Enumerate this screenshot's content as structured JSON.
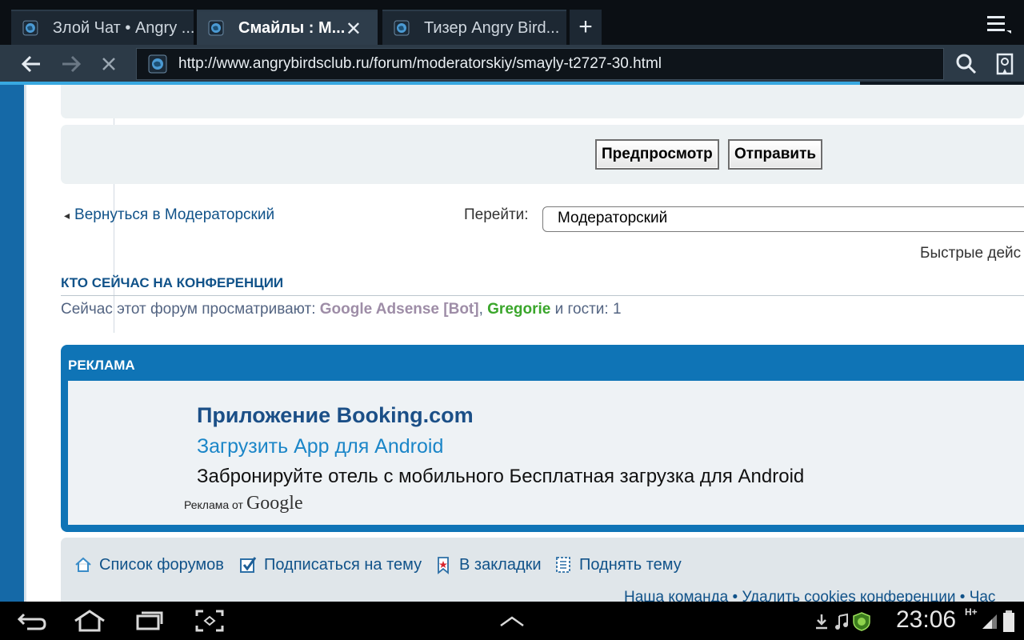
{
  "browser": {
    "tabs": [
      {
        "label": "Злой Чат • Angry ...",
        "active": false
      },
      {
        "label": "Смайлы : М...",
        "active": true
      },
      {
        "label": "Тизер Angry Bird..."
      }
    ],
    "new_tab_label": "+",
    "close_tab_label": "✕",
    "url": "http://www.angrybirdsclub.ru/forum/moderatorskiy/smayly-t2727-30.html",
    "load_progress": 0.84
  },
  "post_form": {
    "preview_label": "Предпросмотр",
    "submit_label": "Отправить"
  },
  "navigation": {
    "back_arrow": "◂",
    "back_link": "Вернуться в Модераторский",
    "jump_label": "Перейти:",
    "jump_selected": "Модераторский",
    "quick_actions": "Быстрые дейс"
  },
  "who_online": {
    "title": "КТО СЕЙЧАС НА КОНФЕРЕНЦИИ",
    "prefix": "Сейчас этот форум просматривают: ",
    "bot": "Google Adsense [Bot]",
    "comma": ", ",
    "user": "Gregorie",
    "suffix": " и гости: 1"
  },
  "ad": {
    "header": "РЕКЛАМА",
    "title": "Приложение Booking.com",
    "subtitle": "Загрузить App для Android",
    "description": "Забронируйте отель с мобильного Бесплатная загрузка для Android",
    "by_label": "Реклама от",
    "google_label": "Google"
  },
  "footer": {
    "forum_list": "Список форумов",
    "subscribe": "Подписаться на тему",
    "bookmark": "В закладки",
    "bump": "Поднять тему",
    "links": "Наша команда • Удалить cookies конференции • Час"
  },
  "system_bar": {
    "clock": "23:06",
    "network": "H+"
  },
  "colors": {
    "link": "#105289",
    "bot": "#9e8da7",
    "user": "#3aa62b",
    "ad_frame": "#0f74b6",
    "progress": "#38a8e0"
  }
}
